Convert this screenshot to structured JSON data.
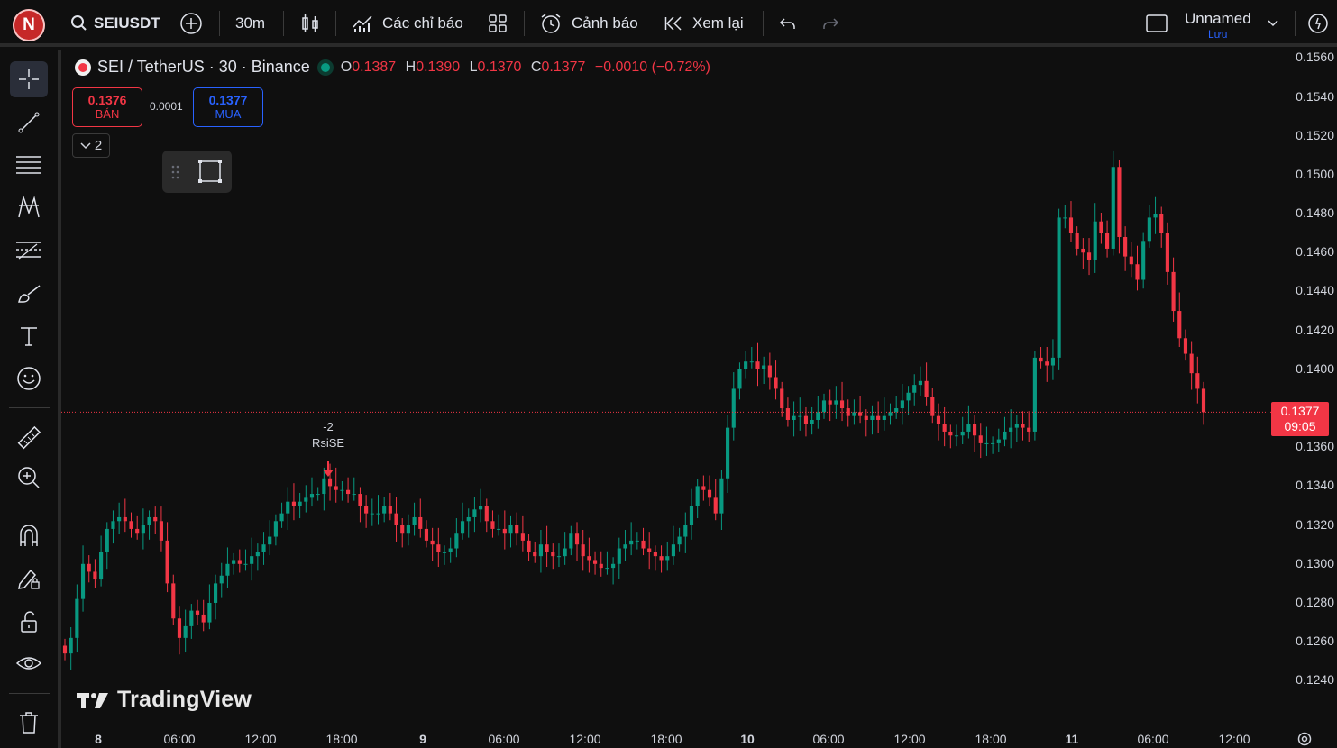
{
  "topbar": {
    "avatar_letter": "N",
    "symbol": "SEIUSDT",
    "interval": "30m",
    "indicators_label": "Các chỉ báo",
    "alerts_label": "Cảnh báo",
    "replay_label": "Xem lại",
    "layout_name": "Unnamed",
    "save_label": "Lưu"
  },
  "legend": {
    "title": "SEI / TetherUS · 30 · Binance",
    "o_key": "O",
    "o_val": "0.1387",
    "h_key": "H",
    "h_val": "0.1390",
    "l_key": "L",
    "l_val": "0.1370",
    "c_key": "C",
    "c_val": "0.1377",
    "change": "−0.0010 (−0.72%)"
  },
  "trade": {
    "sell_price": "0.1376",
    "sell_label": "BÁN",
    "spread": "0.0001",
    "buy_price": "0.1377",
    "buy_label": "MUA",
    "collapse_count": "2"
  },
  "marker": {
    "value": "-2",
    "label": "RsiSE"
  },
  "current_price": {
    "price": "0.1377",
    "countdown": "09:05"
  },
  "logo_text": "TradingView",
  "colors": {
    "up": "#089981",
    "down": "#f23645",
    "background": "#0f0f0f",
    "accent": "#2962ff"
  },
  "chart_data": {
    "type": "candlestick",
    "ylim": [
      0.1236,
      0.1562
    ],
    "y_ticks": [
      "0.1560",
      "0.1540",
      "0.1520",
      "0.1500",
      "0.1480",
      "0.1460",
      "0.1440",
      "0.1420",
      "0.1400",
      "0.1360",
      "0.1340",
      "0.1320",
      "0.1300",
      "0.1280",
      "0.1260",
      "0.1240"
    ],
    "x_ticks": [
      "8",
      "06:00",
      "12:00",
      "18:00",
      "9",
      "06:00",
      "12:00",
      "18:00",
      "10",
      "06:00",
      "12:00",
      "18:00",
      "11",
      "06:00",
      "12:00"
    ],
    "close_series": [
      0.1254,
      0.1262,
      0.1282,
      0.13,
      0.1296,
      0.1292,
      0.1306,
      0.1318,
      0.1322,
      0.1324,
      0.1322,
      0.1318,
      0.1316,
      0.132,
      0.1324,
      0.1322,
      0.1312,
      0.129,
      0.1272,
      0.1262,
      0.1268,
      0.1276,
      0.1274,
      0.127,
      0.128,
      0.129,
      0.1294,
      0.13,
      0.1302,
      0.13,
      0.13,
      0.1304,
      0.1306,
      0.131,
      0.1314,
      0.1322,
      0.1326,
      0.1332,
      0.133,
      0.1332,
      0.1334,
      0.1336,
      0.1336,
      0.1344,
      0.134,
      0.1338,
      0.1338,
      0.1336,
      0.1336,
      0.133,
      0.1326,
      0.1326,
      0.1326,
      0.133,
      0.1326,
      0.132,
      0.1316,
      0.132,
      0.1324,
      0.1318,
      0.1312,
      0.131,
      0.1306,
      0.1306,
      0.1308,
      0.1316,
      0.1322,
      0.1324,
      0.1328,
      0.133,
      0.1322,
      0.1318,
      0.1318,
      0.1316,
      0.132,
      0.1316,
      0.1312,
      0.1306,
      0.1304,
      0.131,
      0.1306,
      0.1304,
      0.1304,
      0.1308,
      0.1316,
      0.131,
      0.1304,
      0.1302,
      0.13,
      0.1298,
      0.1298,
      0.13,
      0.1308,
      0.131,
      0.1312,
      0.1312,
      0.1308,
      0.1306,
      0.1304,
      0.1302,
      0.1304,
      0.131,
      0.1314,
      0.132,
      0.133,
      0.134,
      0.1338,
      0.1334,
      0.1326,
      0.1344,
      0.137,
      0.139,
      0.14,
      0.1404,
      0.1404,
      0.14,
      0.1402,
      0.1396,
      0.139,
      0.138,
      0.1374,
      0.1376,
      0.1376,
      0.1372,
      0.1374,
      0.1378,
      0.1384,
      0.1382,
      0.1384,
      0.138,
      0.1376,
      0.1378,
      0.1376,
      0.1374,
      0.1376,
      0.1374,
      0.1376,
      0.1378,
      0.138,
      0.1384,
      0.1388,
      0.1392,
      0.1394,
      0.1386,
      0.1376,
      0.1372,
      0.1368,
      0.1366,
      0.1366,
      0.1368,
      0.1372,
      0.1366,
      0.1362,
      0.1362,
      0.1362,
      0.1364,
      0.1368,
      0.137,
      0.1372,
      0.137,
      0.1368,
      0.1406,
      0.1404,
      0.1402,
      0.1406,
      0.1478,
      0.1478,
      0.147,
      0.1462,
      0.146,
      0.1456,
      0.1476,
      0.147,
      0.1462,
      0.1504,
      0.1468,
      0.1458,
      0.1454,
      0.1446,
      0.1466,
      0.1478,
      0.148,
      0.147,
      0.145,
      0.143,
      0.1416,
      0.1408,
      0.1398,
      0.139,
      0.1378
    ]
  }
}
